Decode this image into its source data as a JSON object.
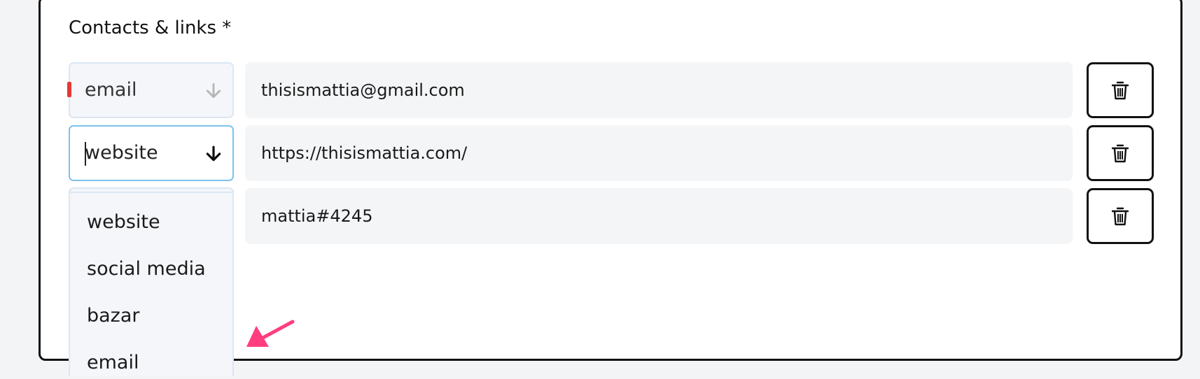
{
  "section": {
    "title": "Contacts & links *"
  },
  "rows": [
    {
      "type": "email",
      "value": "thisismattia@gmail.com"
    },
    {
      "type": "website",
      "value": "https://thisismattia.com/"
    },
    {
      "type": "",
      "value": "mattia#4245"
    }
  ],
  "dropdown": {
    "options": [
      "website",
      "social media",
      "bazar",
      "email"
    ]
  },
  "icons": {
    "select_arrow": "arrow-down-icon",
    "delete": "trash-icon",
    "annotation": "pointer-arrow-icon",
    "error": "error-icon"
  },
  "colors": {
    "focus_border": "#7cc1ee",
    "error": "#e53935",
    "annotation_arrow": "#ff3d7f"
  }
}
